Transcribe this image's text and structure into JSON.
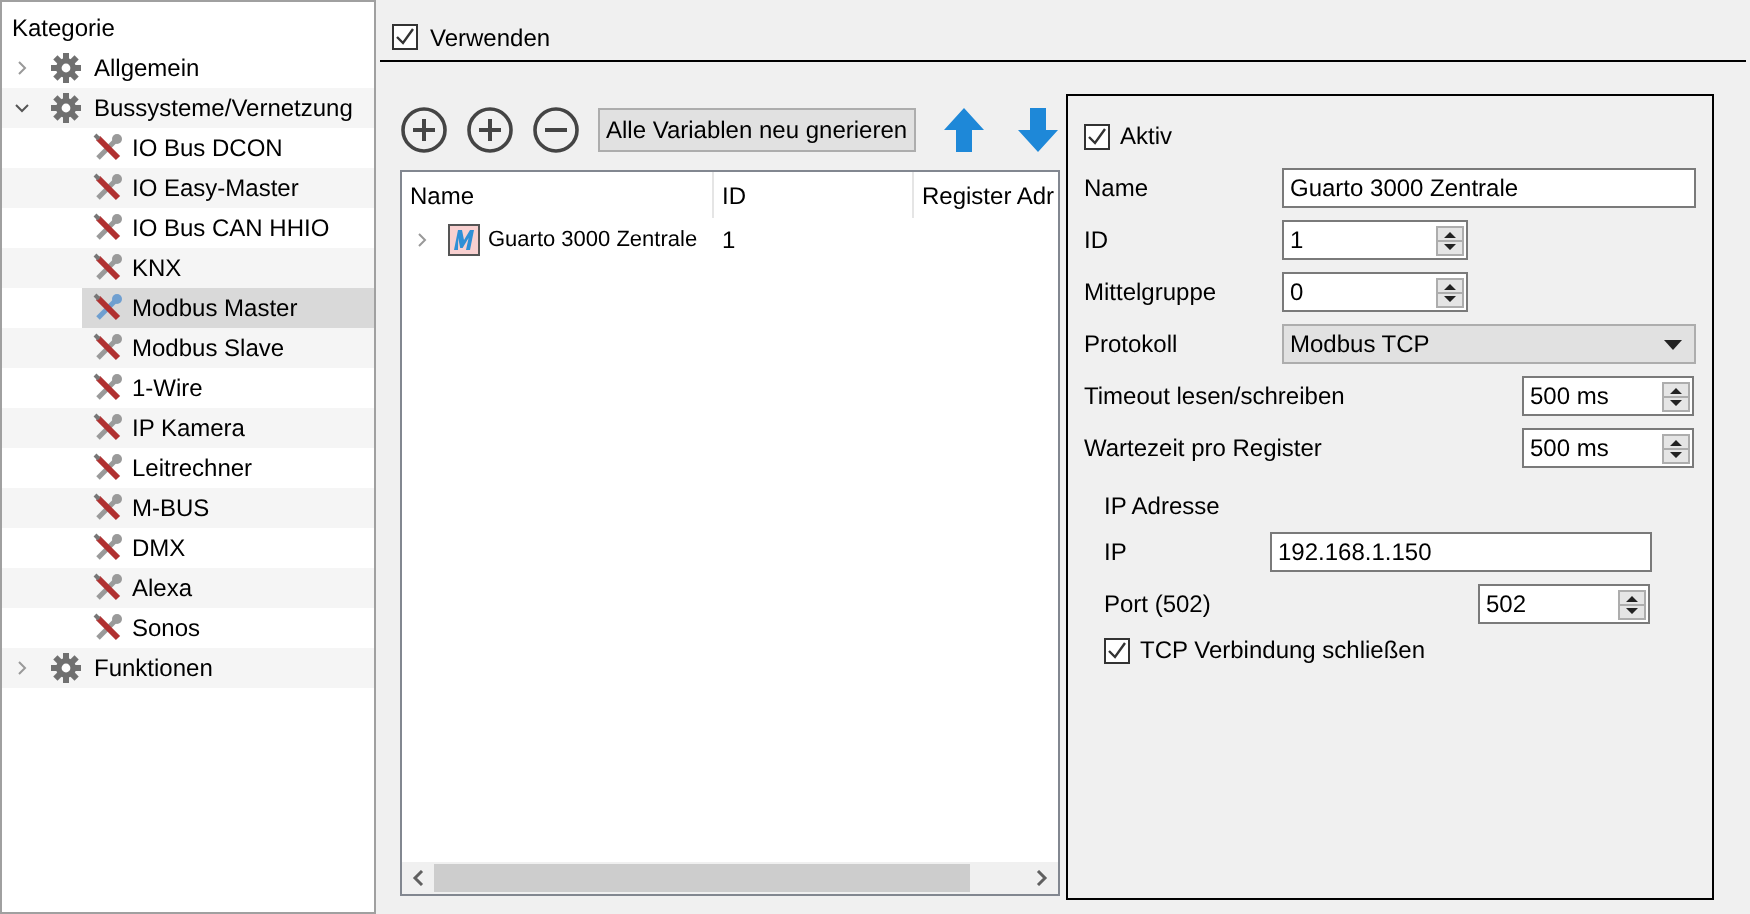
{
  "sidebar": {
    "header": "Kategorie",
    "items": [
      {
        "kind": "category",
        "label": "Allgemein",
        "expanded": false
      },
      {
        "kind": "category",
        "label": "Bussysteme/Vernetzung",
        "expanded": true,
        "children": [
          {
            "label": "IO Bus DCON",
            "selected": false
          },
          {
            "label": "IO Easy-Master",
            "selected": false
          },
          {
            "label": "IO Bus CAN HHIO",
            "selected": false
          },
          {
            "label": "KNX",
            "selected": false
          },
          {
            "label": "Modbus Master",
            "selected": true
          },
          {
            "label": "Modbus Slave",
            "selected": false
          },
          {
            "label": "1-Wire",
            "selected": false
          },
          {
            "label": "IP Kamera",
            "selected": false
          },
          {
            "label": "Leitrechner",
            "selected": false
          },
          {
            "label": "M-BUS",
            "selected": false
          },
          {
            "label": "DMX",
            "selected": false
          },
          {
            "label": "Alexa",
            "selected": false
          },
          {
            "label": "Sonos",
            "selected": false
          }
        ]
      },
      {
        "kind": "category",
        "label": "Funktionen",
        "expanded": false
      }
    ]
  },
  "use_checkbox": {
    "label": "Verwenden",
    "checked": true
  },
  "toolbar": [
    {
      "kind": "add"
    },
    {
      "kind": "add"
    },
    {
      "kind": "remove"
    },
    {
      "kind": "text",
      "label": "Alle Variablen neu gnerieren"
    },
    {
      "kind": "up"
    },
    {
      "kind": "down"
    }
  ],
  "table": {
    "columns": [
      "Name",
      "ID",
      "Register Adr"
    ],
    "rows": [
      {
        "name": "Guarto 3000 Zentrale",
        "id": "1",
        "expanded": false
      }
    ]
  },
  "details": {
    "active": {
      "label": "Aktiv",
      "checked": true
    },
    "fields": [
      {
        "kind": "text",
        "label": "Name",
        "value": "Guarto 3000 Zentrale"
      },
      {
        "kind": "spin",
        "label": "ID",
        "value": "1"
      },
      {
        "kind": "spin",
        "label": "Mittelgruppe",
        "value": "0"
      },
      {
        "kind": "select",
        "label": "Protokoll",
        "value": "Modbus TCP"
      },
      {
        "kind": "spin_wide",
        "label": "Timeout lesen/schreiben",
        "value": "500 ms"
      },
      {
        "kind": "spin_wide",
        "label": "Wartezeit pro Register",
        "value": "500 ms"
      }
    ],
    "ip_group": {
      "title": "IP Adresse",
      "fields": [
        {
          "kind": "text",
          "label": "IP",
          "value": "192.168.1.150"
        },
        {
          "kind": "spin_wide",
          "label": "Port (502)",
          "value": "502"
        }
      ]
    },
    "tcp_close": {
      "label": "TCP Verbindung schließen",
      "checked": true
    }
  }
}
